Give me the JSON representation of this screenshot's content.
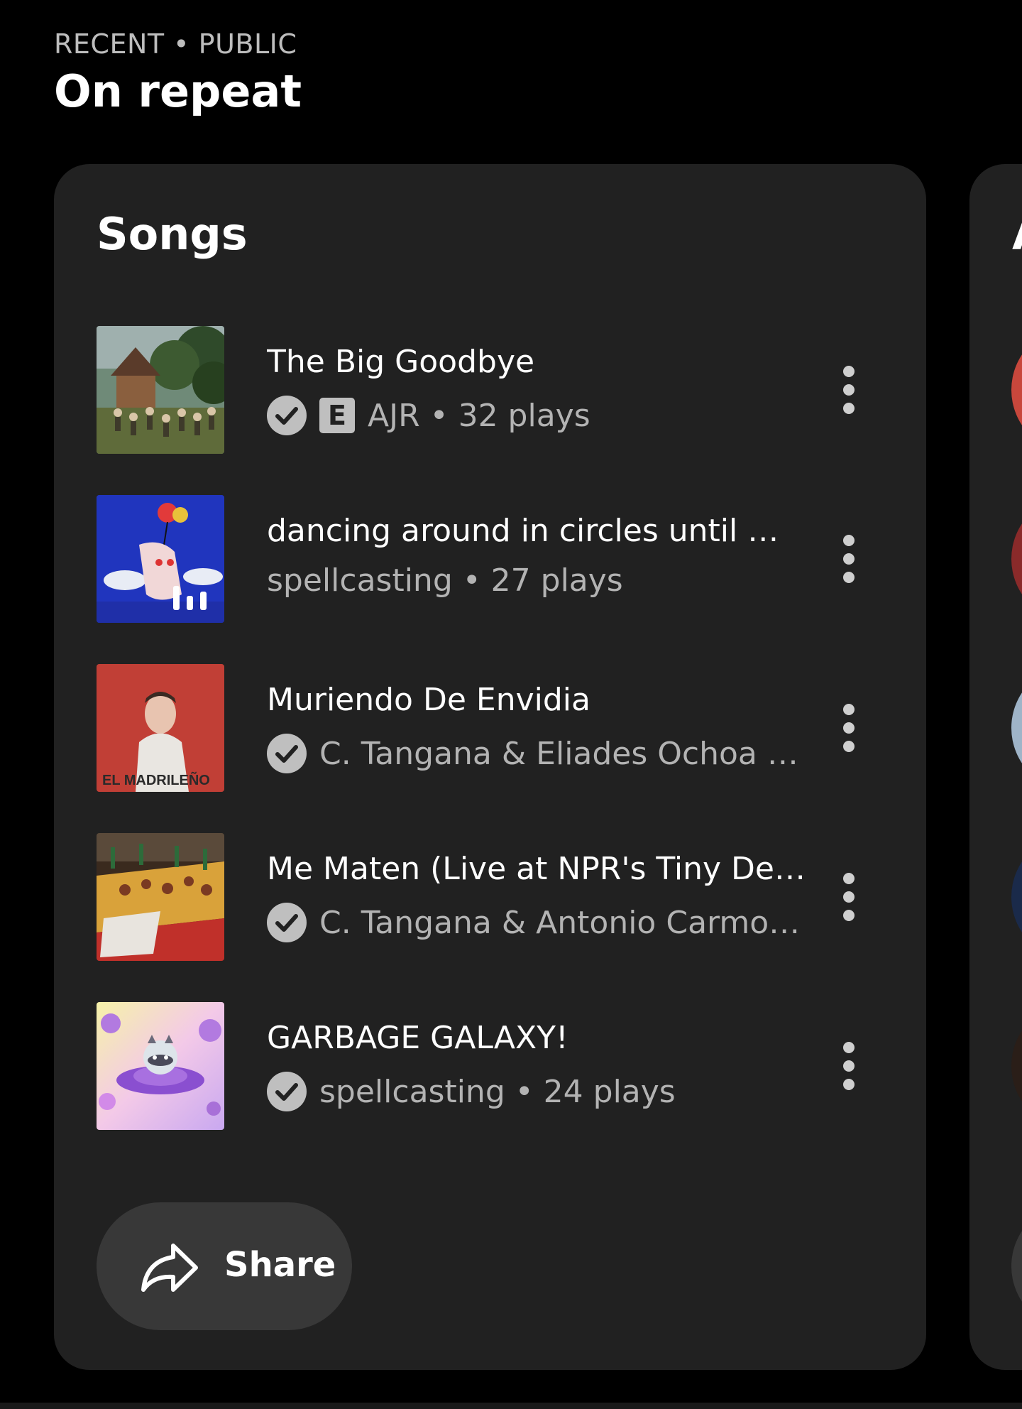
{
  "header": {
    "kicker": "RECENT • PUBLIC",
    "title": "On repeat"
  },
  "songs_card": {
    "title": "Songs",
    "items": [
      {
        "title": "The Big Goodbye",
        "meta": "AJR • 32 plays",
        "verified": true,
        "explicit": true,
        "explicit_label": "E",
        "art": "forest-party-art"
      },
      {
        "title": "dancing around in circles until my...",
        "meta": "spellcasting • 27 plays",
        "verified": false,
        "explicit": false,
        "now_playing": true,
        "art": "crayon-balloon-art"
      },
      {
        "title": "Muriendo De Envidia",
        "meta": "C. Tangana & Eliades Ochoa • 2...",
        "verified": true,
        "explicit": false,
        "art": "el-madrileno-art",
        "art_text": "EL MADRILEÑO"
      },
      {
        "title": "Me Maten (Live at NPR's Tiny Desk)",
        "meta": "C. Tangana & Antonio Carmona...",
        "verified": true,
        "explicit": false,
        "art": "banquet-table-art"
      },
      {
        "title": "GARBAGE GALAXY!",
        "meta": "spellcasting • 24 plays",
        "verified": true,
        "explicit": false,
        "art": "raccoon-ufo-art"
      }
    ]
  },
  "share": {
    "label": "Share"
  },
  "next_card": {
    "title_peek": "A"
  },
  "colors": {
    "background": "#000000",
    "card": "#212121",
    "share_pill": "#383838",
    "secondary_text": "#b3b3b3"
  }
}
